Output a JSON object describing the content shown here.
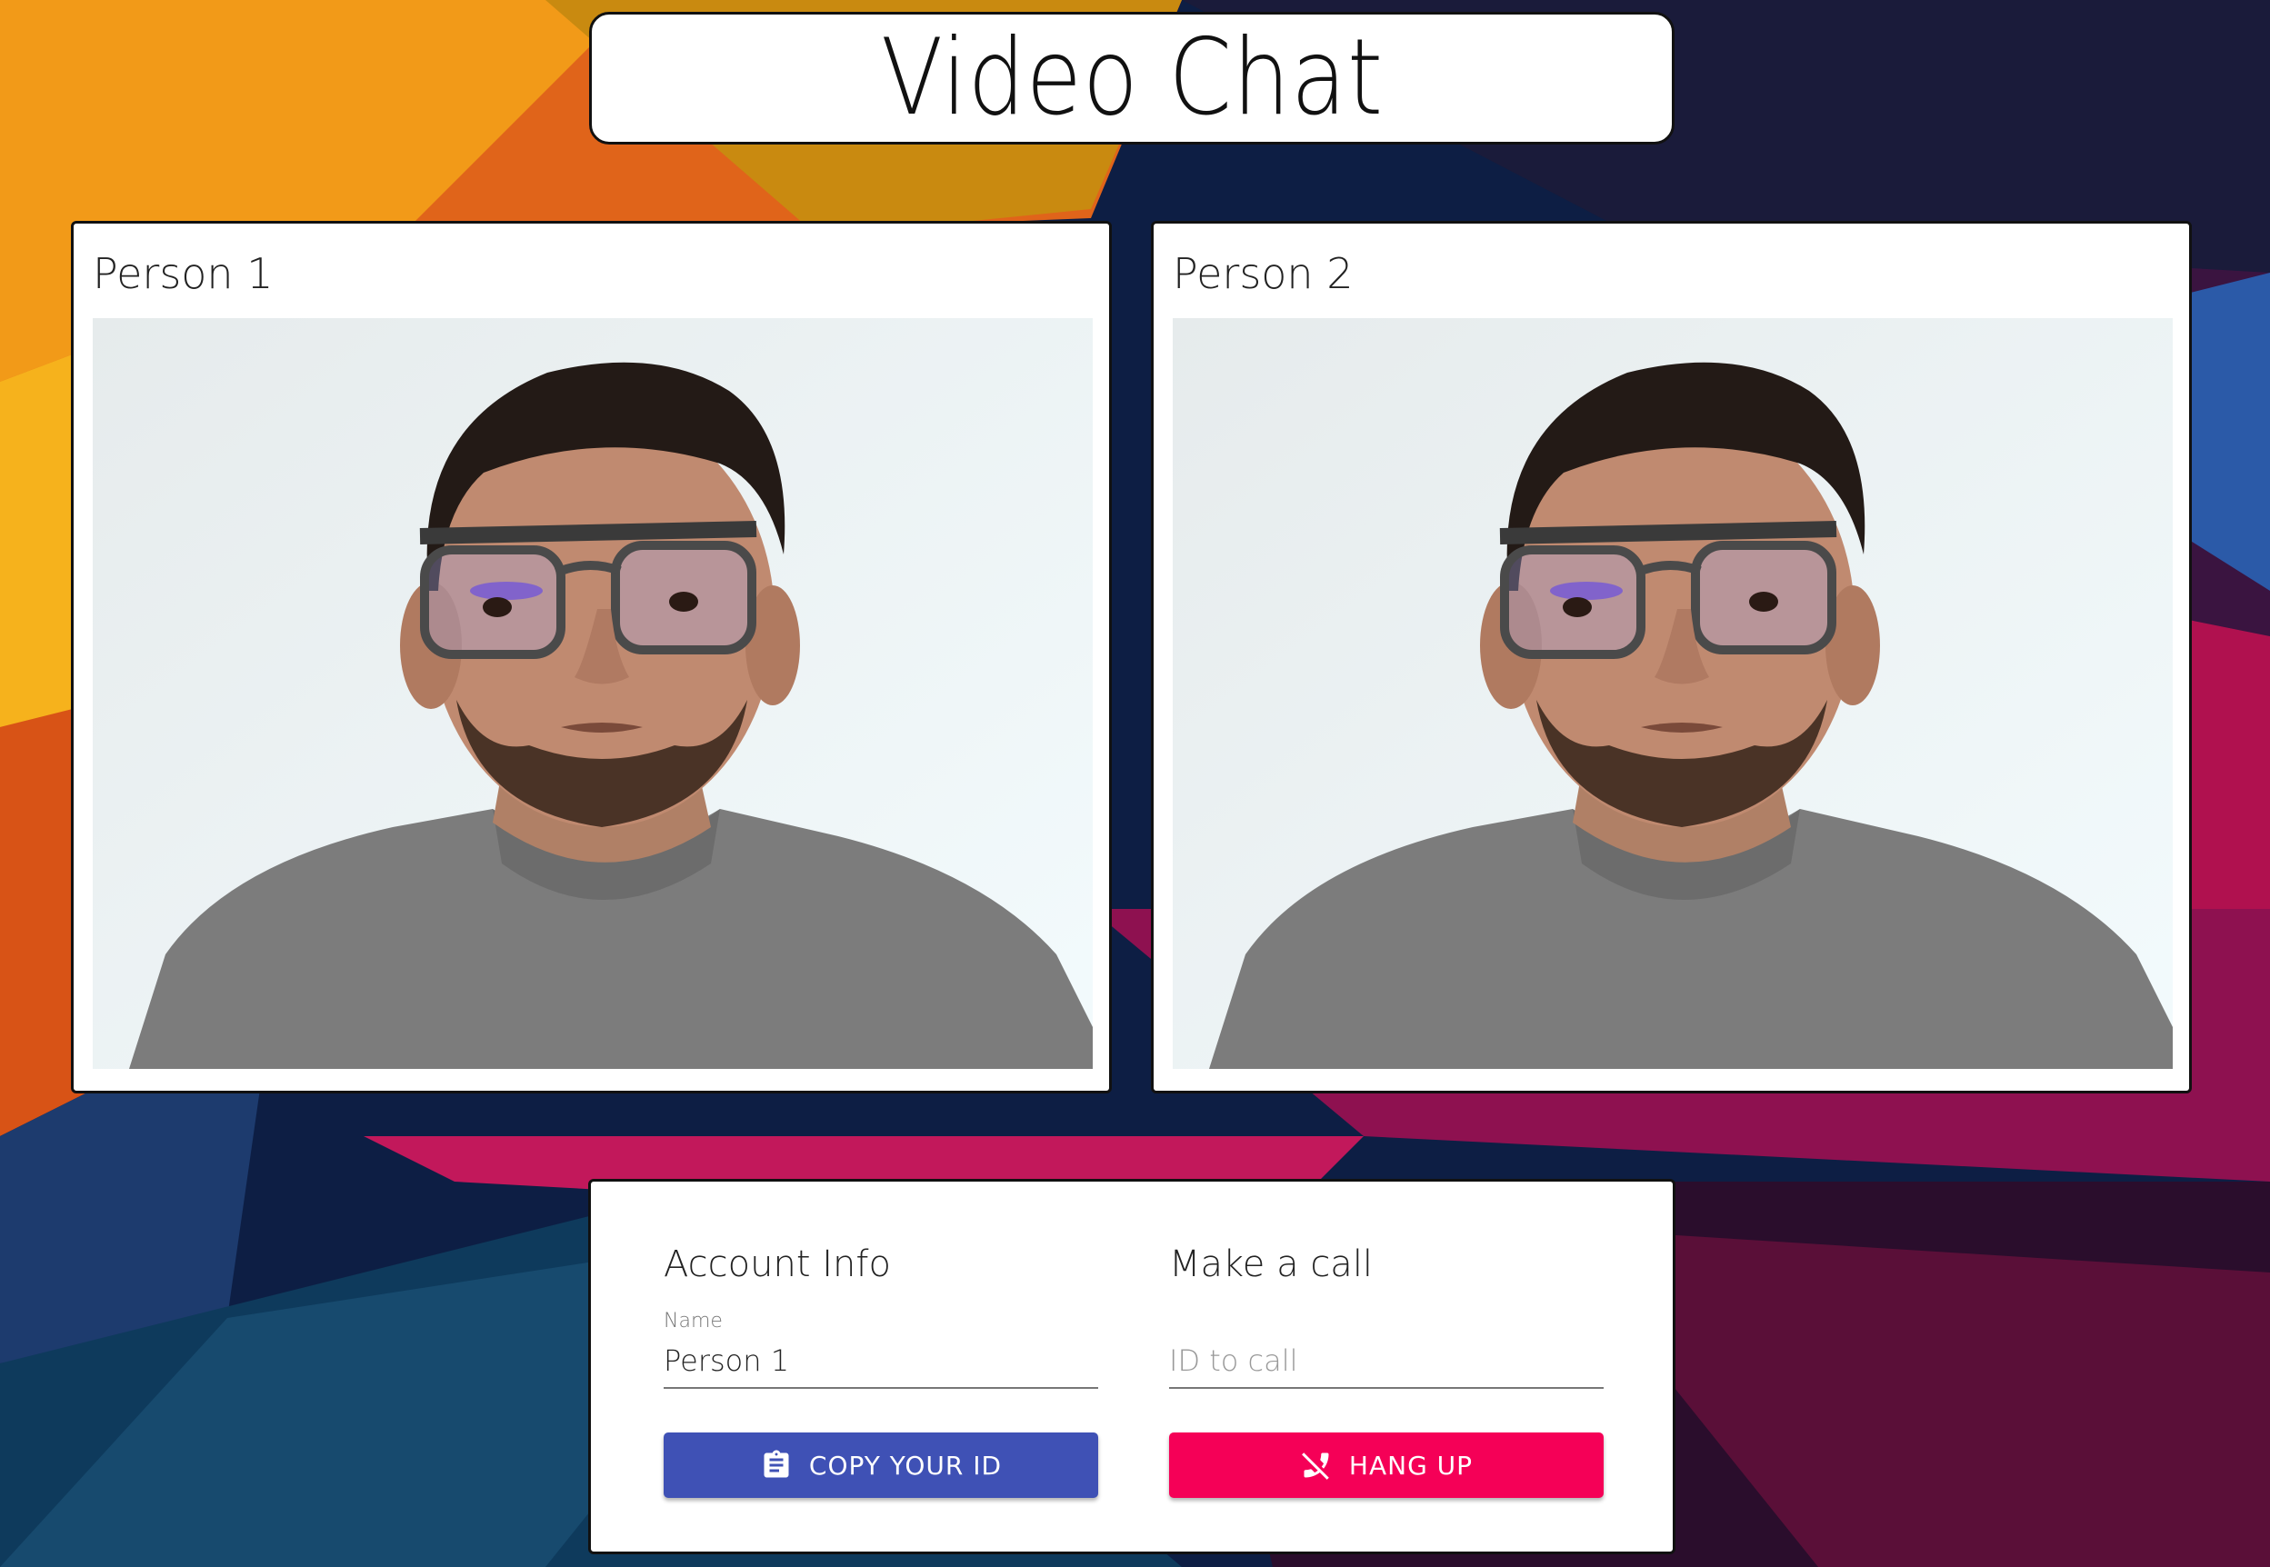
{
  "header": {
    "title": "Video Chat"
  },
  "videos": [
    {
      "label": "Person 1"
    },
    {
      "label": "Person 2"
    }
  ],
  "account": {
    "title": "Account Info",
    "name_label": "Name",
    "name_value": "Person 1",
    "copy_button_label": "COPY YOUR ID",
    "copy_icon": "clipboard-icon"
  },
  "call": {
    "title": "Make a call",
    "id_placeholder": "ID to call",
    "id_value": "",
    "hangup_button_label": "HANG UP",
    "hangup_icon": "phone-disabled-icon"
  },
  "colors": {
    "primary": "#3f51b5",
    "secondary": "#f50057",
    "card_bg": "#ffffff",
    "card_border": "#111111"
  }
}
